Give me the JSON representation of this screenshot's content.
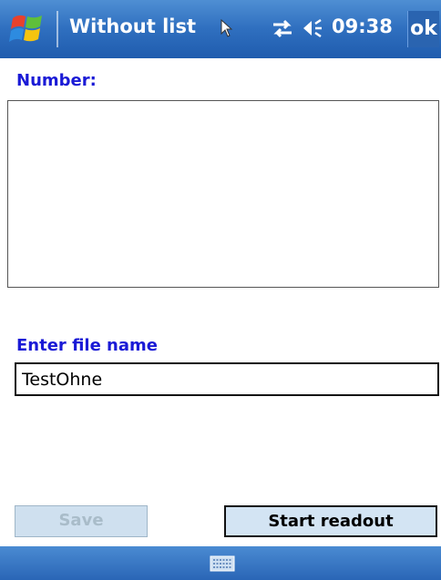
{
  "titlebar": {
    "title": "Without list",
    "time": "09:38",
    "ok_label": "ok",
    "icons": [
      "windows-start-icon",
      "cursor-icon",
      "sync-icon",
      "volume-icon"
    ]
  },
  "form": {
    "number_label": "Number:",
    "number_value": "",
    "file_label": "Enter file name",
    "file_value": "TestOhne"
  },
  "buttons": {
    "save_label": "Save",
    "save_enabled": false,
    "start_label": "Start readout"
  },
  "bottombar": {
    "icons": [
      "keyboard-icon"
    ]
  },
  "colors": {
    "titlebar": "#2f6fbf",
    "label": "#1a1ad6",
    "button_face": "#d3e4f3"
  }
}
